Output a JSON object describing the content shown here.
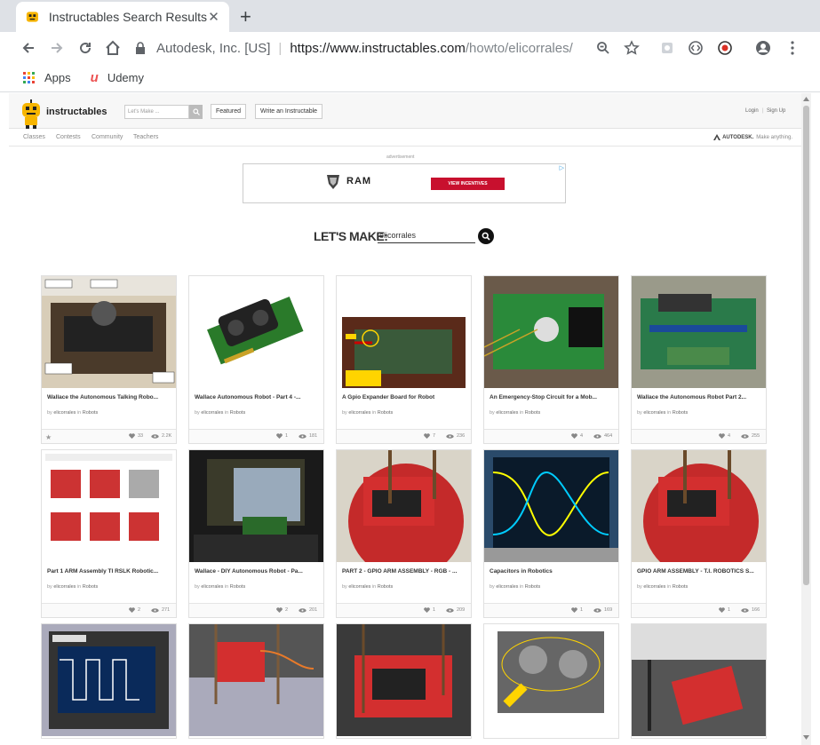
{
  "browser": {
    "tab_title": "Instructables Search Results",
    "origin": "Autodesk, Inc. [US]",
    "url_host": "https://www.instructables.com",
    "url_path": "/howto/elicorrales/",
    "bookmarks": [
      {
        "label": "Apps",
        "icon": "apps-grid-icon"
      },
      {
        "label": "Udemy",
        "icon": "udemy-icon"
      }
    ]
  },
  "site": {
    "logo_text": "instructables",
    "search_placeholder": "Let's Make ...",
    "featured_btn": "Featured",
    "write_btn": "Write an Instructable",
    "login": "Login",
    "sep": "|",
    "signup": "Sign Up",
    "subnav": [
      "Classes",
      "Contests",
      "Community",
      "Teachers"
    ],
    "autodesk_brand": "AUTODESK.",
    "autodesk_tag": "Make anything."
  },
  "ad": {
    "label": "advertisement",
    "brand": "RAM",
    "button": "VIEW INCENTIVES",
    "corner": "▷"
  },
  "search": {
    "label": "LET'S MAKE:",
    "query": "elicorrales"
  },
  "cards": [
    {
      "title": "Wallace the Autonomous Talking Robo...",
      "author": "elicorrales",
      "category": "Robots",
      "favorites": "33",
      "views": "2.2K",
      "img": "robot-1"
    },
    {
      "title": "Wallace Autonomous Robot - Part 4 -...",
      "author": "elicorrales",
      "category": "Robots",
      "favorites": "1",
      "views": "181",
      "img": "sensor"
    },
    {
      "title": "A Gpio Expander Board for Robot",
      "author": "elicorrales",
      "category": "Robots",
      "favorites": "7",
      "views": "236",
      "img": "gpio"
    },
    {
      "title": "An Emergency-Stop Circuit for a Mob...",
      "author": "elicorrales",
      "category": "Robots",
      "favorites": "4",
      "views": "464",
      "img": "estop"
    },
    {
      "title": "Wallace the Autonomous Robot Part 2...",
      "author": "elicorrales",
      "category": "Robots",
      "favorites": "4",
      "views": "255",
      "img": "board"
    },
    {
      "title": "Part 1 ARM Assembly TI RSLK Robotic...",
      "author": "elicorrales",
      "category": "Robots",
      "favorites": "2",
      "views": "271",
      "img": "screens"
    },
    {
      "title": "Wallace - DIY Autonomous Robot - Pa...",
      "author": "elicorrales",
      "category": "Robots",
      "favorites": "2",
      "views": "201",
      "img": "monitor"
    },
    {
      "title": "PART 2 - GPIO ARM ASSEMBLY - RGB - ...",
      "author": "elicorrales",
      "category": "Robots",
      "favorites": "1",
      "views": "209",
      "img": "red-robot"
    },
    {
      "title": "Capacitors in Robotics",
      "author": "elicorrales",
      "category": "Robots",
      "favorites": "1",
      "views": "169",
      "img": "scope"
    },
    {
      "title": "GPIO ARM ASSEMBLY - T.I. ROBOTICS S...",
      "author": "elicorrales",
      "category": "Robots",
      "favorites": "1",
      "views": "166",
      "img": "red-robot"
    },
    {
      "title": "",
      "author": "",
      "category": "",
      "favorites": "",
      "views": "",
      "img": "scope2"
    },
    {
      "title": "",
      "author": "",
      "category": "",
      "favorites": "",
      "views": "",
      "img": "red-board"
    },
    {
      "title": "",
      "author": "",
      "category": "",
      "favorites": "",
      "views": "",
      "img": "red-board2"
    },
    {
      "title": "",
      "author": "",
      "category": "",
      "favorites": "",
      "views": "",
      "img": "ultrasonic"
    },
    {
      "title": "",
      "author": "",
      "category": "",
      "favorites": "",
      "views": "",
      "img": "red-board3"
    }
  ],
  "labels": {
    "by": "by",
    "in": "in"
  }
}
